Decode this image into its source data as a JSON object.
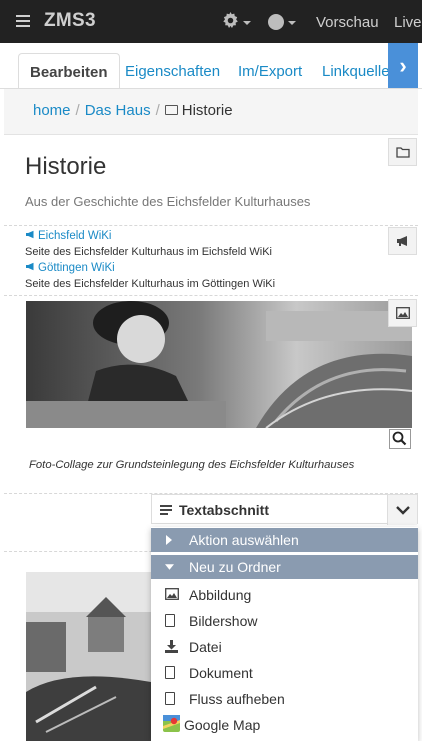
{
  "navbar": {
    "brand": "ZMS3",
    "links": [
      "Vorschau",
      "Live"
    ]
  },
  "tabs": {
    "items": [
      "Bearbeiten",
      "Eigenschaften",
      "Im/Export",
      "Linkquellen"
    ],
    "active": "Bearbeiten"
  },
  "breadcrumb": {
    "items": [
      "home",
      "Das Haus"
    ],
    "current": "Historie"
  },
  "page": {
    "title": "Historie",
    "subtitle": "Aus der Geschichte des Eichsfelder Kulturhauses"
  },
  "links": [
    {
      "label": "Eichsfeld WiKi",
      "description": "Seite des Eichsfelder Kulturhaus im Eichsfeld WiKi"
    },
    {
      "label": "Göttingen WiKi",
      "description": "Seite des Eichsfelder Kulturhaus im Göttingen WiKi"
    }
  ],
  "image": {
    "caption": "Foto-Collage zur Grundsteinlegung des Eichsfelder Kulturhauses"
  },
  "dropdown": {
    "selected": "Textabschnitt",
    "groups": [
      "Aktion auswählen",
      "Neu zu Ordner"
    ],
    "items": [
      "Abbildung",
      "Bildershow",
      "Datei",
      "Dokument",
      "Fluss aufheben",
      "Google Map"
    ]
  },
  "colors": {
    "navbar_bg": "#222222",
    "link": "#1a8ac6",
    "accent": "#4a90d9",
    "menu_group_bg": "#8a9bb0"
  },
  "icons": [
    "menu-icon",
    "gear-icon",
    "globe-icon",
    "chevron-right-icon",
    "folder-icon",
    "bullhorn-icon",
    "image-icon",
    "magnifier-icon",
    "text-lines-icon",
    "chevron-down-icon",
    "caret-right-icon",
    "caret-down-icon",
    "document-icon",
    "download-icon",
    "map-icon"
  ]
}
